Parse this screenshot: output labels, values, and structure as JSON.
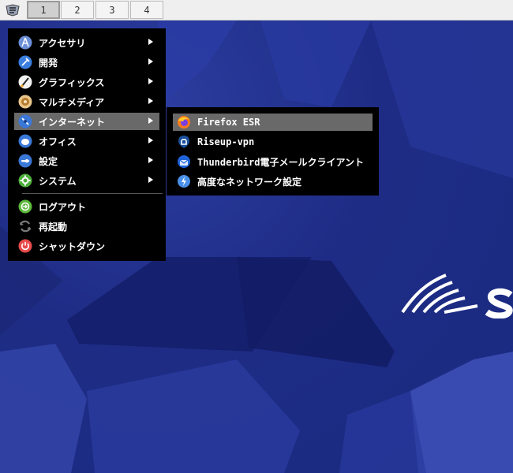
{
  "taskbar": {
    "workspaces": [
      "1",
      "2",
      "3",
      "4"
    ],
    "active_workspace": "1"
  },
  "menu": {
    "items": [
      {
        "label": "アクセサリ",
        "icon": "accessories-icon",
        "submenu": true
      },
      {
        "label": "開発",
        "icon": "development-icon",
        "submenu": true
      },
      {
        "label": "グラフィックス",
        "icon": "graphics-icon",
        "submenu": true
      },
      {
        "label": "マルチメディア",
        "icon": "multimedia-icon",
        "submenu": true
      },
      {
        "label": "インターネット",
        "icon": "internet-icon",
        "submenu": true,
        "highlighted": true
      },
      {
        "label": "オフィス",
        "icon": "office-icon",
        "submenu": true
      },
      {
        "label": "設定",
        "icon": "settings-icon",
        "submenu": true
      },
      {
        "label": "システム",
        "icon": "system-icon",
        "submenu": true
      }
    ],
    "actions": [
      {
        "label": "ログアウト",
        "icon": "logout-icon"
      },
      {
        "label": "再起動",
        "icon": "restart-icon"
      },
      {
        "label": "シャットダウン",
        "icon": "shutdown-icon"
      }
    ]
  },
  "submenu": {
    "items": [
      {
        "label": "Firefox ESR",
        "icon": "firefox-icon",
        "highlighted": true
      },
      {
        "label": "Riseup-vpn",
        "icon": "riseup-vpn-icon"
      },
      {
        "label": "Thunderbird電子メールクライアント",
        "icon": "thunderbird-icon"
      },
      {
        "label": "高度なネットワーク設定",
        "icon": "network-settings-icon"
      }
    ]
  },
  "colors": {
    "menu_bg": "#000000",
    "highlight": "#696969",
    "desktop_bg": "#1f2f8a"
  }
}
